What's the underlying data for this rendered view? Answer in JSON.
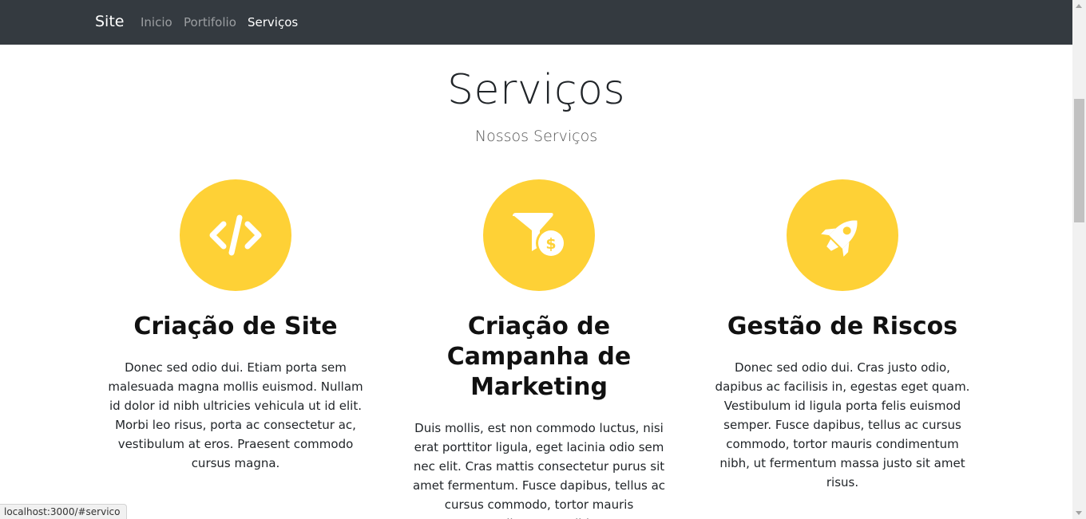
{
  "navbar": {
    "brand": "Site",
    "links": [
      {
        "label": "Inicio",
        "active": false
      },
      {
        "label": "Portifolio",
        "active": false
      },
      {
        "label": "Serviços",
        "active": true
      }
    ]
  },
  "section": {
    "title": "Serviços",
    "subtitle": "Nossos Serviços"
  },
  "services": [
    {
      "icon": "code-icon",
      "heading": "Criação de Site",
      "text": "Donec sed odio dui. Etiam porta sem malesuada magna mollis euismod. Nullam id dolor id nibh ultricies vehicula ut id elit. Morbi leo risus, porta ac consectetur ac, vestibulum at eros. Praesent commodo cursus magna."
    },
    {
      "icon": "funnel-dollar-icon",
      "heading": "Criação de Campanha de Marketing",
      "text": "Duis mollis, est non commodo luctus, nisi erat porttitor ligula, eget lacinia odio sem nec elit. Cras mattis consectetur purus sit amet fermentum. Fusce dapibus, tellus ac cursus commodo, tortor mauris condimentum nibh."
    },
    {
      "icon": "rocket-icon",
      "heading": "Gestão de Riscos",
      "text": "Donec sed odio dui. Cras justo odio, dapibus ac facilisis in, egestas eget quam. Vestibulum id ligula porta felis euismod semper. Fusce dapibus, tellus ac cursus commodo, tortor mauris condimentum nibh, ut fermentum massa justo sit amet risus."
    }
  ],
  "status_bar": {
    "url": "localhost:3000/#servico"
  },
  "colors": {
    "navbar_bg": "#343a40",
    "accent": "#fed136"
  }
}
